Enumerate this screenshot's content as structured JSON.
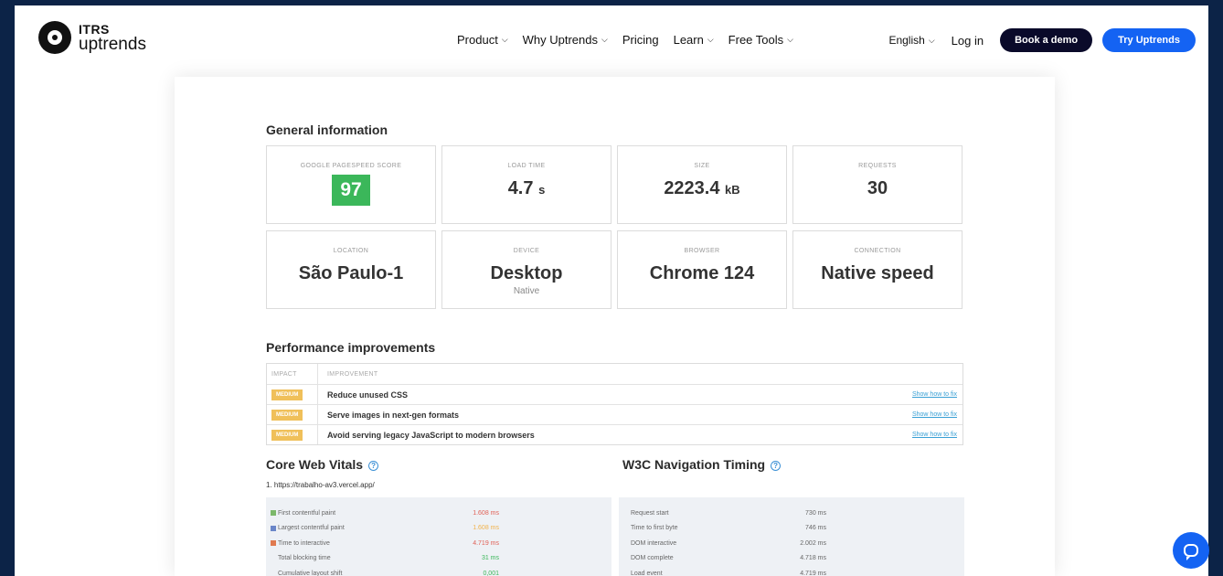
{
  "brand": {
    "top": "ITRS",
    "bottom": "uptrends"
  },
  "nav": {
    "items": [
      {
        "label": "Product",
        "chevron": true
      },
      {
        "label": "Why Uptrends",
        "chevron": true
      },
      {
        "label": "Pricing",
        "chevron": false
      },
      {
        "label": "Learn",
        "chevron": true
      },
      {
        "label": "Free Tools",
        "chevron": true
      }
    ],
    "language": "English",
    "login": "Log in",
    "book_demo": "Book a demo",
    "try": "Try Uptrends"
  },
  "general": {
    "title": "General information",
    "tiles": [
      {
        "label": "GOOGLE PAGESPEED SCORE",
        "value": "97"
      },
      {
        "label": "LOAD TIME",
        "value": "4.7",
        "unit": "s"
      },
      {
        "label": "SIZE",
        "value": "2223.4",
        "unit": "kB"
      },
      {
        "label": "REQUESTS",
        "value": "30"
      },
      {
        "label": "LOCATION",
        "value": "São Paulo-1"
      },
      {
        "label": "DEVICE",
        "value": "Desktop",
        "sub": "Native"
      },
      {
        "label": "BROWSER",
        "value": "Chrome 124"
      },
      {
        "label": "CONNECTION",
        "value": "Native speed"
      }
    ]
  },
  "performance": {
    "title": "Performance improvements",
    "head_impact": "IMPACT",
    "head_improvement": "IMPROVEMENT",
    "rows": [
      {
        "impact": "MEDIUM",
        "text": "Reduce unused CSS",
        "link": "Show how to fix"
      },
      {
        "impact": "MEDIUM",
        "text": "Serve images in next-gen formats",
        "link": "Show how to fix"
      },
      {
        "impact": "MEDIUM",
        "text": "Avoid serving legacy JavaScript to modern browsers",
        "link": "Show how to fix"
      }
    ]
  },
  "vitals": {
    "title": "Core Web Vitals",
    "url": "1. https://trabalho-av3.vercel.app/",
    "rows": [
      {
        "name": "First contentful paint",
        "value": "1.608 ms",
        "swatch": "#7cb86a",
        "color": "#e06055"
      },
      {
        "name": "Largest contentful paint",
        "value": "1.608 ms",
        "swatch": "#6a86c8",
        "color": "#f2b24a"
      },
      {
        "name": "Time to interactive",
        "value": "4.719 ms",
        "swatch": "#e07a50",
        "color": "#e06055"
      },
      {
        "name": "Total blocking time",
        "value": "31 ms",
        "swatch": "",
        "color": "#3bb75a"
      },
      {
        "name": "Cumulative layout shift",
        "value": "0,001",
        "swatch": "",
        "color": "#3bb75a"
      }
    ]
  },
  "navtiming": {
    "title": "W3C Navigation Timing",
    "rows": [
      {
        "name": "Request start",
        "value": "730 ms"
      },
      {
        "name": "Time to first byte",
        "value": "746 ms"
      },
      {
        "name": "DOM interactive",
        "value": "2.002 ms"
      },
      {
        "name": "DOM complete",
        "value": "4.718 ms"
      },
      {
        "name": "Load event",
        "value": "4.719 ms"
      }
    ]
  }
}
